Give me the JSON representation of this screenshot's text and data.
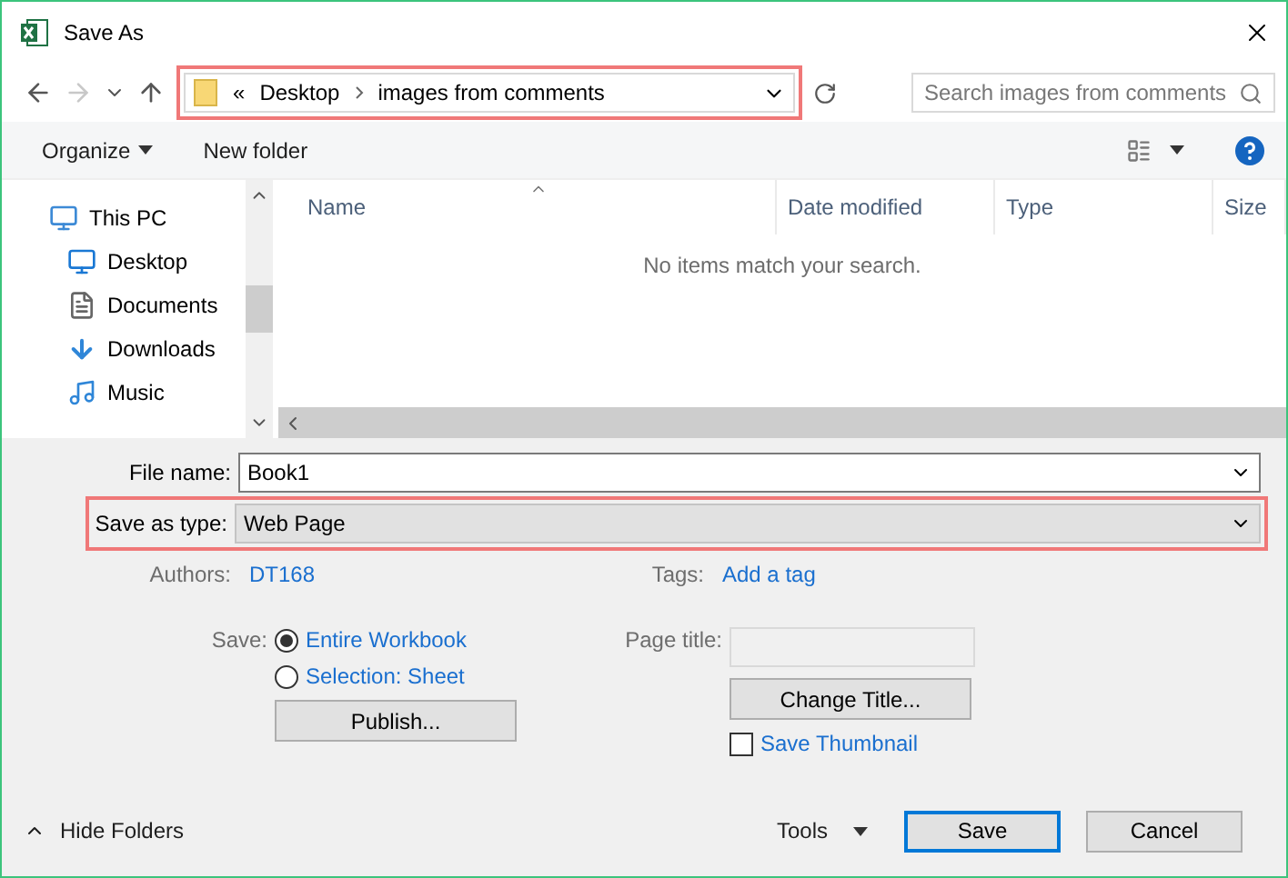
{
  "window": {
    "title": "Save As"
  },
  "nav_buttons": [
    {
      "kind": "back",
      "disabled": false
    },
    {
      "kind": "forward",
      "disabled": true
    },
    {
      "kind": "recent",
      "disabled": false
    },
    {
      "kind": "up",
      "disabled": false
    }
  ],
  "address": {
    "prefix": "«",
    "crumbs": [
      "Desktop",
      "images from comments"
    ],
    "highlighted": true
  },
  "search": {
    "placeholder": "Search images from comments"
  },
  "toolbar": {
    "organize": "Organize",
    "new_folder": "New folder"
  },
  "sidebar": {
    "items": [
      {
        "label": "This PC",
        "kind": "pc",
        "children": [
          {
            "label": "Desktop",
            "kind": "desktop"
          },
          {
            "label": "Documents",
            "kind": "documents"
          },
          {
            "label": "Downloads",
            "kind": "downloads"
          },
          {
            "label": "Music",
            "kind": "music"
          }
        ]
      }
    ]
  },
  "table": {
    "columns": [
      "Name",
      "Date modified",
      "Type",
      "Size"
    ],
    "empty_message": "No items match your search."
  },
  "form": {
    "file_name": {
      "label": "File name:",
      "value": "Book1"
    },
    "save_as_type": {
      "label": "Save as type:",
      "value": "Web Page",
      "highlighted": true
    },
    "authors": {
      "label": "Authors:",
      "value": "DT168"
    },
    "tags": {
      "label": "Tags:",
      "value": "Add a tag"
    },
    "save": {
      "label": "Save:",
      "options": [
        {
          "label": "Entire Workbook",
          "selected": true
        },
        {
          "label": "Selection: Sheet",
          "selected": false
        }
      ],
      "publish": "Publish..."
    },
    "page_title": {
      "label": "Page title:",
      "change": "Change Title..."
    },
    "save_thumbnail": {
      "label": "Save Thumbnail",
      "checked": false
    }
  },
  "footer": {
    "hide_folders": "Hide Folders",
    "tools": "Tools",
    "buttons": [
      {
        "label": "Save",
        "default": true
      },
      {
        "label": "Cancel",
        "default": false
      }
    ]
  }
}
